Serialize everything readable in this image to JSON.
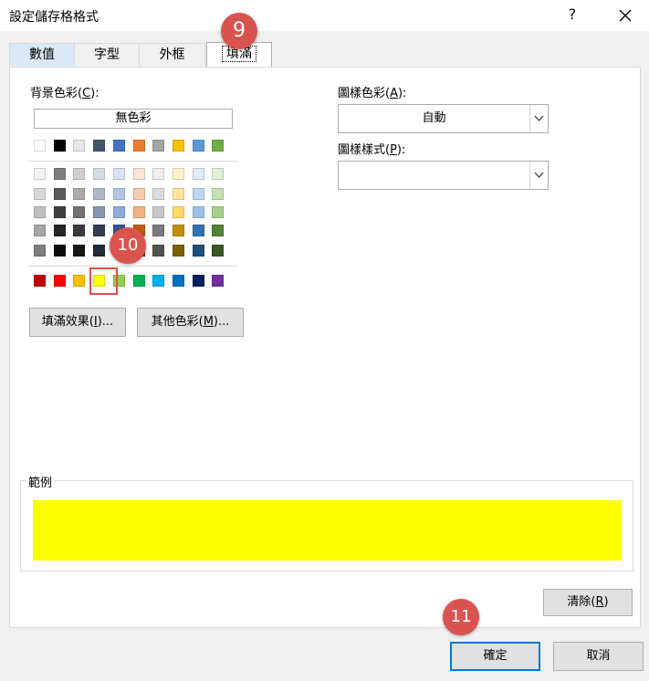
{
  "dialog": {
    "title": "設定儲存格格式",
    "help": "?",
    "tabs": [
      "數值",
      "字型",
      "外框",
      "填滿"
    ]
  },
  "fill": {
    "background_label": "背景色彩(",
    "background_key": "C",
    "no_color": "無色彩",
    "pattern_color_label": "圖樣色彩(",
    "pattern_color_key": "A",
    "pattern_color_value": "自動",
    "pattern_style_label": "圖樣樣式(",
    "pattern_style_key": "P",
    "fill_effects_label": "填滿效果(",
    "fill_effects_key": "I",
    "more_colors_label": "其他色彩(",
    "more_colors_key": "M",
    "label_end": "):",
    "button_end": ")...",
    "theme_top_row": [
      "#ffffff",
      "#000000",
      "#e7e6e6",
      "#44546a",
      "#4472c4",
      "#ed7d31",
      "#a5a5a5",
      "#ffc000",
      "#5b9bd5",
      "#70ad47"
    ],
    "theme_tints": [
      [
        "#f2f2f2",
        "#7f7f7f",
        "#d0cece",
        "#d6dce4",
        "#d9e2f3",
        "#fbe4d5",
        "#ededed",
        "#fff2cc",
        "#deebf6",
        "#e2efd9"
      ],
      [
        "#d8d8d8",
        "#595959",
        "#aeabab",
        "#adb9ca",
        "#b4c6e7",
        "#f7cbac",
        "#dbdbdb",
        "#fee599",
        "#bdd7ee",
        "#c5e0b3"
      ],
      [
        "#bfbfbf",
        "#3f3f3f",
        "#757070",
        "#8496b0",
        "#8eaadb",
        "#f4b183",
        "#c9c9c9",
        "#ffd965",
        "#9cc3e5",
        "#a8d08d"
      ],
      [
        "#a5a5a5",
        "#262626",
        "#3a3838",
        "#323f4f",
        "#2f5496",
        "#c55a11",
        "#7b7b7b",
        "#bf8f00",
        "#2e75b5",
        "#538135"
      ],
      [
        "#7f7f7f",
        "#0c0c0c",
        "#171616",
        "#222a35",
        "#1f3864",
        "#833c0b",
        "#525252",
        "#7f6000",
        "#1e4e79",
        "#375623"
      ]
    ],
    "standard_colors": [
      "#c00000",
      "#ff0000",
      "#ffc000",
      "#ffff00",
      "#92d050",
      "#00b050",
      "#00b0f0",
      "#0070c0",
      "#002060",
      "#7030a0"
    ],
    "sample_label": "範例",
    "sample_color": "#ffff00",
    "clear_label": "清除(",
    "clear_key": "R",
    "clear_end": ")"
  },
  "footer": {
    "ok": "確定",
    "cancel": "取消"
  },
  "markers": [
    "9",
    "10",
    "11"
  ]
}
